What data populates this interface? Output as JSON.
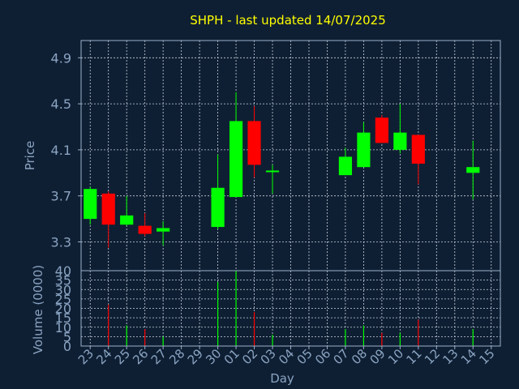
{
  "chart_data": [
    {
      "type": "candlestick",
      "title": "SHPH - last updated 14/07/2025",
      "ylabel": "Price",
      "ylim": [
        3.05,
        5.05
      ],
      "yticks": [
        "4.9",
        "4.5",
        "4.1",
        "3.7",
        "3.3"
      ],
      "grid": true,
      "colors": {
        "up": "#00ff00",
        "down": "#ff0000",
        "doji": "#00ff00"
      },
      "candles": [
        {
          "day": "23",
          "open": 3.5,
          "high": 3.78,
          "low": 3.45,
          "close": 3.76
        },
        {
          "day": "24",
          "open": 3.72,
          "high": 3.74,
          "low": 3.25,
          "close": 3.45
        },
        {
          "day": "25",
          "open": 3.45,
          "high": 3.7,
          "low": 3.44,
          "close": 3.53
        },
        {
          "day": "26",
          "open": 3.44,
          "high": 3.55,
          "low": 3.35,
          "close": 3.37
        },
        {
          "day": "27",
          "open": 3.39,
          "high": 3.48,
          "low": 3.27,
          "close": 3.42
        },
        {
          "day": "30",
          "open": 3.43,
          "high": 4.06,
          "low": 3.41,
          "close": 3.77
        },
        {
          "day": "01",
          "open": 3.69,
          "high": 4.6,
          "low": 3.69,
          "close": 4.35
        },
        {
          "day": "02",
          "open": 4.35,
          "high": 4.48,
          "low": 3.86,
          "close": 3.97
        },
        {
          "day": "03",
          "open": 3.91,
          "high": 3.97,
          "low": 3.72,
          "close": 3.92
        },
        {
          "day": "07",
          "open": 3.88,
          "high": 4.12,
          "low": 3.88,
          "close": 4.04
        },
        {
          "day": "08",
          "open": 3.95,
          "high": 4.34,
          "low": 3.95,
          "close": 4.25
        },
        {
          "day": "09",
          "open": 4.38,
          "high": 4.4,
          "low": 4.16,
          "close": 4.16
        },
        {
          "day": "10",
          "open": 4.1,
          "high": 4.5,
          "low": 4.07,
          "close": 4.25
        },
        {
          "day": "11",
          "open": 4.23,
          "high": 4.23,
          "low": 3.8,
          "close": 3.98
        },
        {
          "day": "14",
          "open": 3.9,
          "high": 4.18,
          "low": 3.67,
          "close": 3.95
        }
      ]
    },
    {
      "type": "bar",
      "xlabel": "Day",
      "ylabel": "Volume (0000)",
      "ylim": [
        0,
        40
      ],
      "yticks": [
        "40",
        "35",
        "30",
        "25",
        "20",
        "15",
        "10",
        "5",
        "0"
      ],
      "grid": true,
      "categories": [
        "23",
        "24",
        "25",
        "26",
        "27",
        "28",
        "29",
        "30",
        "01",
        "02",
        "03",
        "04",
        "05",
        "06",
        "07",
        "08",
        "09",
        "10",
        "11",
        "12",
        "13",
        "14",
        "15"
      ],
      "volumes": [
        {
          "day": "24",
          "value": 22,
          "color": "#ff0000"
        },
        {
          "day": "25",
          "value": 11,
          "color": "#00ff00"
        },
        {
          "day": "26",
          "value": 9,
          "color": "#ff0000"
        },
        {
          "day": "27",
          "value": 5,
          "color": "#00ff00"
        },
        {
          "day": "30",
          "value": 34,
          "color": "#00ff00"
        },
        {
          "day": "01",
          "value": 40,
          "color": "#00ff00"
        },
        {
          "day": "02",
          "value": 18,
          "color": "#ff0000"
        },
        {
          "day": "03",
          "value": 6,
          "color": "#00ff00"
        },
        {
          "day": "07",
          "value": 9,
          "color": "#00ff00"
        },
        {
          "day": "08",
          "value": 11,
          "color": "#00ff00"
        },
        {
          "day": "09",
          "value": 7,
          "color": "#ff0000"
        },
        {
          "day": "10",
          "value": 7,
          "color": "#00ff00"
        },
        {
          "day": "11",
          "value": 14,
          "color": "#ff0000"
        },
        {
          "day": "14",
          "value": 9,
          "color": "#00ff00"
        }
      ]
    }
  ],
  "theme": {
    "background": "#0f1f33",
    "axis": "#9ab0c9",
    "text": "#8aa4c2",
    "title": "#ffff00",
    "grid": "#c8d2e0"
  }
}
